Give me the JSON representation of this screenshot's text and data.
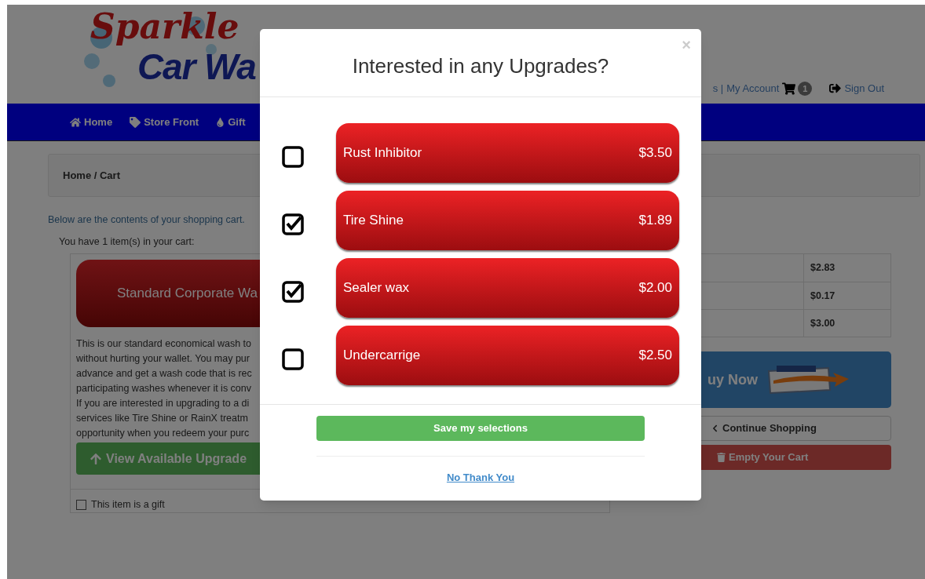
{
  "header": {
    "logo_top": "Sparkle",
    "logo_bottom": "Car Wa",
    "links_cut": "s |",
    "account": "My Account",
    "cart_count": "1",
    "sign_out": "Sign Out"
  },
  "nav": [
    {
      "label": "Home",
      "kind": "home"
    },
    {
      "label": "Store Front",
      "kind": "tag"
    },
    {
      "label": "Gift",
      "kind": "drop"
    }
  ],
  "breadcrumb": "Home / Cart",
  "intro": "Below are the contents of your shopping cart.",
  "count_text": "You have 1 item(s) in your cart:",
  "item": {
    "title": "Standard Corporate Wa",
    "description": [
      "This is our standard economical wash to",
      "without hurting your wallet. You may pur",
      "advance and get a wash code that is rec",
      "participating washes whenever it is conv",
      "If you are interested in upgrading to a di",
      "services like Tire Shine or RainX treatm",
      "opportunity when you redeem your purc"
    ],
    "upgrades_button": "View Available Upgrade",
    "gift_label": "This item is a gift",
    "gift_checked": false
  },
  "totals": [
    "$2.83",
    "$0.17",
    "$3.00"
  ],
  "buy_now": "uy Now",
  "continue": "Continue Shopping",
  "empty": "Empty Your Cart",
  "modal": {
    "title": "Interested in any Upgrades?",
    "close": "×",
    "upgrades": [
      {
        "name": "Rust Inhibitor",
        "price": "$3.50",
        "checked": false
      },
      {
        "name": "Tire Shine",
        "price": "$1.89",
        "checked": true
      },
      {
        "name": "Sealer wax",
        "price": "$2.00",
        "checked": true
      },
      {
        "name": "Undercarrige",
        "price": "$2.50",
        "checked": false
      }
    ],
    "save": "Save my selections",
    "decline": "No Thank You"
  }
}
